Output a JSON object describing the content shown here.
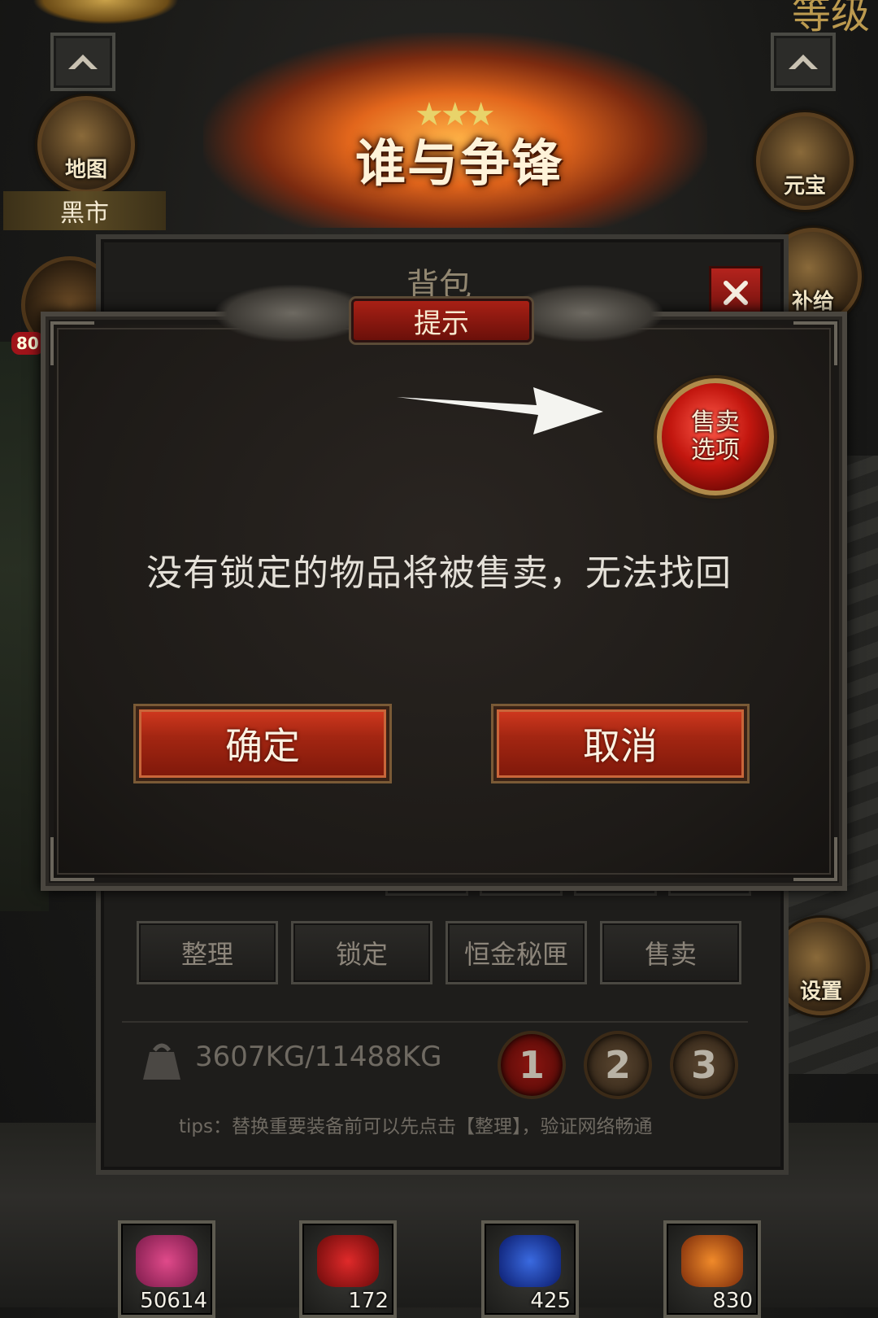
{
  "top": {
    "banner_title": "谁与争锋",
    "corner_right_text": "等级"
  },
  "left_side": {
    "map_label": "地图",
    "black_market_label": "黑市",
    "badge_text": "80"
  },
  "right_side": {
    "yuanbao_label": "元宝",
    "other_label": "补给",
    "settings_label": "设置"
  },
  "bag": {
    "title": "背包",
    "buttons": [
      "整理",
      "锁定",
      "恒金秘匣",
      "售卖"
    ],
    "weight": "3607KG/11488KG",
    "pages": [
      "1",
      "2",
      "3"
    ],
    "tips": "tips：替换重要装备前可以先点击【整理】，验证网络畅通"
  },
  "dialog": {
    "header": "提示",
    "message": "没有锁定的物品将被售卖，无法找回",
    "sell_option_line1": "售卖",
    "sell_option_line2": "选项",
    "confirm": "确定",
    "cancel": "取消"
  },
  "items": [
    {
      "count": "50614",
      "icon": "scroll-icon"
    },
    {
      "count": "172",
      "icon": "red-potion-icon"
    },
    {
      "count": "425",
      "icon": "blue-potion-icon"
    },
    {
      "count": "830",
      "icon": "gem-icon"
    }
  ],
  "colors": {
    "dialog_bg": "#1d1a17",
    "button_red": "#a32612",
    "header_red": "#a82015",
    "text_light": "#e4e0d8"
  }
}
